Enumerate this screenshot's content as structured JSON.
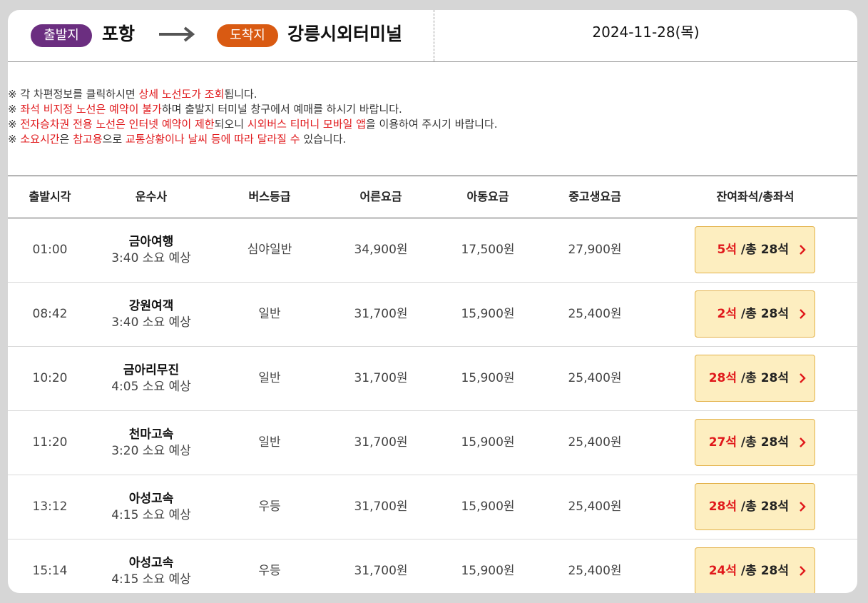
{
  "route": {
    "depart_badge": "출발지",
    "depart_city": "포항",
    "arrive_badge": "도착지",
    "arrive_city": "강릉시외터미널",
    "date": "2024-11-28(목)",
    "colors": {
      "depart_badge": "#6b2e80",
      "arrive_badge": "#d95a12"
    },
    "arrow_icon": "right-arrow-icon"
  },
  "notices": [
    [
      {
        "t": "※ 각 차편정보를 클릭하시면 ",
        "hl": false
      },
      {
        "t": "상세 노선도가 조회",
        "hl": true
      },
      {
        "t": "됩니다.",
        "hl": false
      }
    ],
    [
      {
        "t": "※ ",
        "hl": false
      },
      {
        "t": "좌석 비지정 노선은 예약이 불가",
        "hl": true
      },
      {
        "t": "하며 출발지 터미널 창구에서 예매를 하시기 바랍니다.",
        "hl": false
      }
    ],
    [
      {
        "t": "※ ",
        "hl": false
      },
      {
        "t": "전자승차권 전용 노선은 인터넷 예약이 제한",
        "hl": true
      },
      {
        "t": "되오니 ",
        "hl": false
      },
      {
        "t": "시외버스 티머니 모바일 앱",
        "hl": true
      },
      {
        "t": "을 이용하여 주시기 바랍니다.",
        "hl": false
      }
    ],
    [
      {
        "t": "※ ",
        "hl": false
      },
      {
        "t": "소요시간",
        "hl": true
      },
      {
        "t": "은 ",
        "hl": false
      },
      {
        "t": "참고용",
        "hl": true
      },
      {
        "t": "으로 ",
        "hl": false
      },
      {
        "t": "교통상황이나 날씨 등에 따라 달라질 수",
        "hl": true
      },
      {
        "t": " 있습니다.",
        "hl": false
      }
    ]
  ],
  "table": {
    "headers": {
      "time": "출발시각",
      "company": "운수사",
      "grade": "버스등급",
      "adult": "어른요금",
      "child": "아동요금",
      "youth": "중고생요금",
      "seats": "잔여좌석/총좌석"
    },
    "rows": [
      {
        "time": "01:00",
        "company": "금아여행",
        "duration": "3:40 소요 예상",
        "grade": "심야일반",
        "adult": "34,900원",
        "child": "17,500원",
        "youth": "27,900원",
        "remain": "5석",
        "total": " /총 28석"
      },
      {
        "time": "08:42",
        "company": "강원여객",
        "duration": "3:40 소요 예상",
        "grade": "일반",
        "adult": "31,700원",
        "child": "15,900원",
        "youth": "25,400원",
        "remain": "2석",
        "total": " /총 28석"
      },
      {
        "time": "10:20",
        "company": "금아리무진",
        "duration": "4:05 소요 예상",
        "grade": "일반",
        "adult": "31,700원",
        "child": "15,900원",
        "youth": "25,400원",
        "remain": "28석",
        "total": " /총 28석"
      },
      {
        "time": "11:20",
        "company": "천마고속",
        "duration": "3:20 소요 예상",
        "grade": "일반",
        "adult": "31,700원",
        "child": "15,900원",
        "youth": "25,400원",
        "remain": "27석",
        "total": " /총 28석"
      },
      {
        "time": "13:12",
        "company": "아성고속",
        "duration": "4:15 소요 예상",
        "grade": "우등",
        "adult": "31,700원",
        "child": "15,900원",
        "youth": "25,400원",
        "remain": "28석",
        "total": " /총 28석"
      },
      {
        "time": "15:14",
        "company": "아성고속",
        "duration": "4:15 소요 예상",
        "grade": "우등",
        "adult": "31,700원",
        "child": "15,900원",
        "youth": "25,400원",
        "remain": "24석",
        "total": " /총 28석"
      }
    ],
    "seat_button_icon": "chevron-right-icon",
    "colors": {
      "seat_button_bg": "#fdeec0",
      "highlight": "#e0181b"
    }
  }
}
